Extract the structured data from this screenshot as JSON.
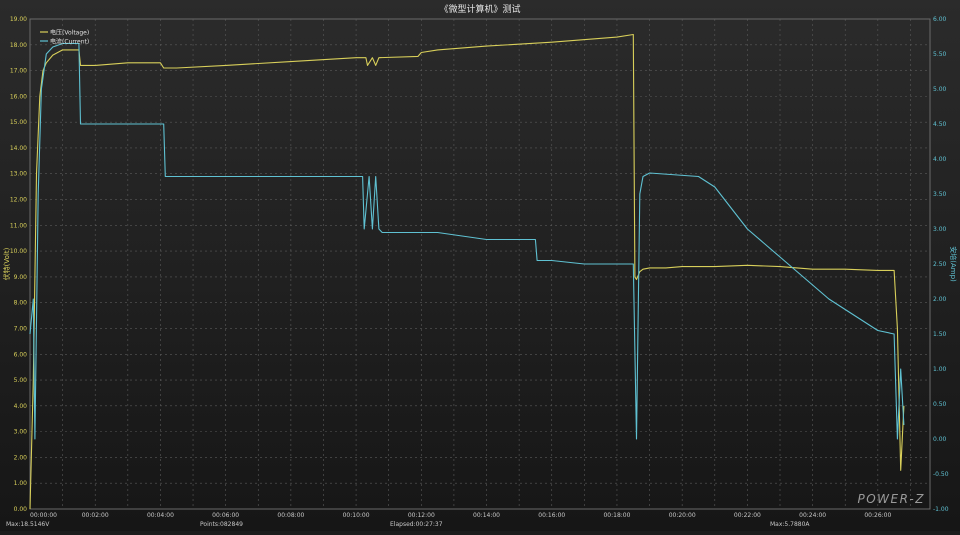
{
  "chart_data": {
    "type": "line",
    "title": "《微型计算机》测试",
    "ylabel_left": "伏特(Volt)",
    "ylabel_right": "安培(Amp)",
    "x_ticks": [
      "00:00:00",
      "00:02:00",
      "00:04:00",
      "00:06:00",
      "00:08:00",
      "00:10:00",
      "00:12:00",
      "00:14:00",
      "00:16:00",
      "00:18:00",
      "00:20:00",
      "00:22:00",
      "00:24:00",
      "00:26:00"
    ],
    "x_unit": "min",
    "xlim": [
      0,
      27.6
    ],
    "y_left_ticks": [
      "0.00",
      "1.00",
      "2.00",
      "3.00",
      "4.00",
      "5.00",
      "6.00",
      "7.00",
      "8.00",
      "9.00",
      "10.00",
      "11.00",
      "12.00",
      "13.00",
      "14.00",
      "15.00",
      "16.00",
      "17.00",
      "18.00",
      "19.00"
    ],
    "y_left_lim": [
      0,
      19
    ],
    "y_right_ticks": [
      "-1.00",
      "-0.50",
      "0.00",
      "0.50",
      "1.00",
      "1.50",
      "2.00",
      "2.50",
      "3.00",
      "3.50",
      "4.00",
      "4.50",
      "5.00",
      "5.50",
      "6.00"
    ],
    "y_right_lim": [
      -1,
      6
    ],
    "grid": true,
    "legend_position": "top-left",
    "series": [
      {
        "name": "电压(Voltage)",
        "axis": "left",
        "color": "#d8cf5a",
        "x": [
          0,
          0.1,
          0.2,
          0.3,
          0.4,
          0.5,
          0.7,
          1.0,
          1.5,
          1.55,
          2.0,
          3.0,
          4.0,
          4.1,
          4.5,
          6.0,
          8.0,
          10.0,
          10.3,
          10.35,
          10.5,
          10.6,
          10.7,
          11.9,
          12.0,
          12.5,
          14.0,
          16.0,
          18.0,
          18.5,
          18.55,
          18.6,
          18.7,
          18.8,
          19.0,
          19.5,
          20.0,
          21.0,
          22.0,
          23.0,
          24.0,
          25.0,
          26.0,
          26.5,
          26.6,
          26.7,
          26.8
        ],
        "y": [
          0.0,
          5.0,
          13.0,
          16.0,
          17.0,
          17.3,
          17.6,
          17.8,
          17.8,
          17.2,
          17.2,
          17.3,
          17.3,
          17.1,
          17.1,
          17.2,
          17.35,
          17.5,
          17.5,
          17.2,
          17.5,
          17.2,
          17.5,
          17.55,
          17.7,
          17.8,
          17.95,
          18.1,
          18.3,
          18.4,
          9.0,
          8.9,
          9.2,
          9.3,
          9.35,
          9.35,
          9.4,
          9.4,
          9.45,
          9.4,
          9.3,
          9.3,
          9.25,
          9.25,
          7.0,
          1.5,
          4.0
        ]
      },
      {
        "name": "电流(Current)",
        "axis": "right",
        "color": "#5fc1d2",
        "x": [
          0,
          0.1,
          0.15,
          0.25,
          0.35,
          0.5,
          0.7,
          1.0,
          1.5,
          1.55,
          4.1,
          4.15,
          10.0,
          10.2,
          10.25,
          10.4,
          10.5,
          10.6,
          10.7,
          10.8,
          11.0,
          12.0,
          12.5,
          14.0,
          15.5,
          15.55,
          16.0,
          17.0,
          18.0,
          18.5,
          18.6,
          18.7,
          18.8,
          19.0,
          20.5,
          21.0,
          21.5,
          22.0,
          22.5,
          23.0,
          23.5,
          24.0,
          24.5,
          25.0,
          25.5,
          26.0,
          26.5,
          26.6,
          26.7,
          26.8
        ],
        "y": [
          1.5,
          2.0,
          0.0,
          3.5,
          5.0,
          5.5,
          5.6,
          5.65,
          5.65,
          4.5,
          4.5,
          3.75,
          3.75,
          3.75,
          3.0,
          3.75,
          3.0,
          3.75,
          3.0,
          2.95,
          2.95,
          2.95,
          2.95,
          2.85,
          2.85,
          2.55,
          2.55,
          2.5,
          2.5,
          2.5,
          0.0,
          3.5,
          3.75,
          3.8,
          3.75,
          3.6,
          3.3,
          3.0,
          2.8,
          2.6,
          2.4,
          2.2,
          2.0,
          1.85,
          1.7,
          1.55,
          1.5,
          0.0,
          1.0,
          0.2
        ]
      }
    ],
    "footer": {
      "max_voltage": "Max:18.5146V",
      "points": "Points:082849",
      "elapsed": "Elapsed:00:27:37",
      "max_current": "Max:5.7880A"
    },
    "brand": "POWER-Z"
  }
}
